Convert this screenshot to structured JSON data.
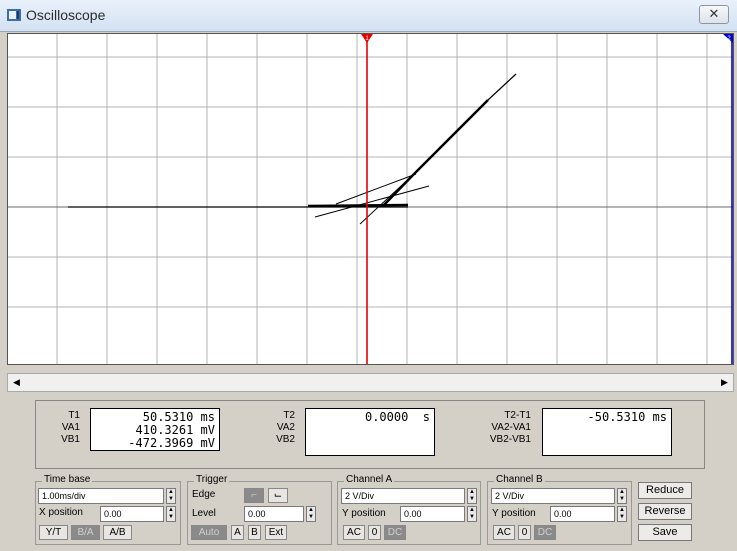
{
  "window": {
    "title": "Oscilloscope",
    "close_glyph": "✕"
  },
  "colors": {
    "cursor1": "#e60000",
    "cursor2": "#0000cc",
    "grid": "#b4b4b4",
    "trace": "#000000"
  },
  "cursors": {
    "t1_label": "1",
    "t2_label": "2"
  },
  "readouts": {
    "t1": {
      "label": "T1",
      "value": "50.5310 ms"
    },
    "va1": {
      "label": "VA1",
      "value": "410.3261 mV"
    },
    "vb1": {
      "label": "VB1",
      "value": "-472.3969 mV"
    },
    "t2": {
      "label": "T2",
      "value": "0.0000  s"
    },
    "va2": {
      "label": "VA2",
      "value": ""
    },
    "vb2": {
      "label": "VB2",
      "value": ""
    },
    "dt": {
      "label": "T2-T1",
      "value": "-50.5310 ms"
    },
    "dva": {
      "label": "VA2-VA1",
      "value": ""
    },
    "dvb": {
      "label": "VB2-VB1",
      "value": ""
    }
  },
  "timebase": {
    "title": "Time base",
    "scale": "1.00ms/div",
    "xpos_label": "X position",
    "xpos": "0.00",
    "modes": [
      "Y/T",
      "B/A",
      "A/B"
    ],
    "active_mode": "B/A"
  },
  "trigger": {
    "title": "Trigger",
    "edge_label": "Edge",
    "level_label": "Level",
    "level": "0.00",
    "sources": [
      "Auto",
      "A",
      "B",
      "Ext"
    ]
  },
  "channel_a": {
    "title": "Channel A",
    "scale": "2 V/Div",
    "ypos_label": "Y position",
    "ypos": "0.00",
    "coupling": [
      "AC",
      "0",
      "DC"
    ]
  },
  "channel_b": {
    "title": "Channel B",
    "scale": "2 V/Div",
    "ypos_label": "Y position",
    "ypos": "0.00",
    "coupling": [
      "AC",
      "0",
      "DC"
    ]
  },
  "actions": {
    "reduce": "Reduce",
    "reverse": "Reverse",
    "save": "Save"
  }
}
